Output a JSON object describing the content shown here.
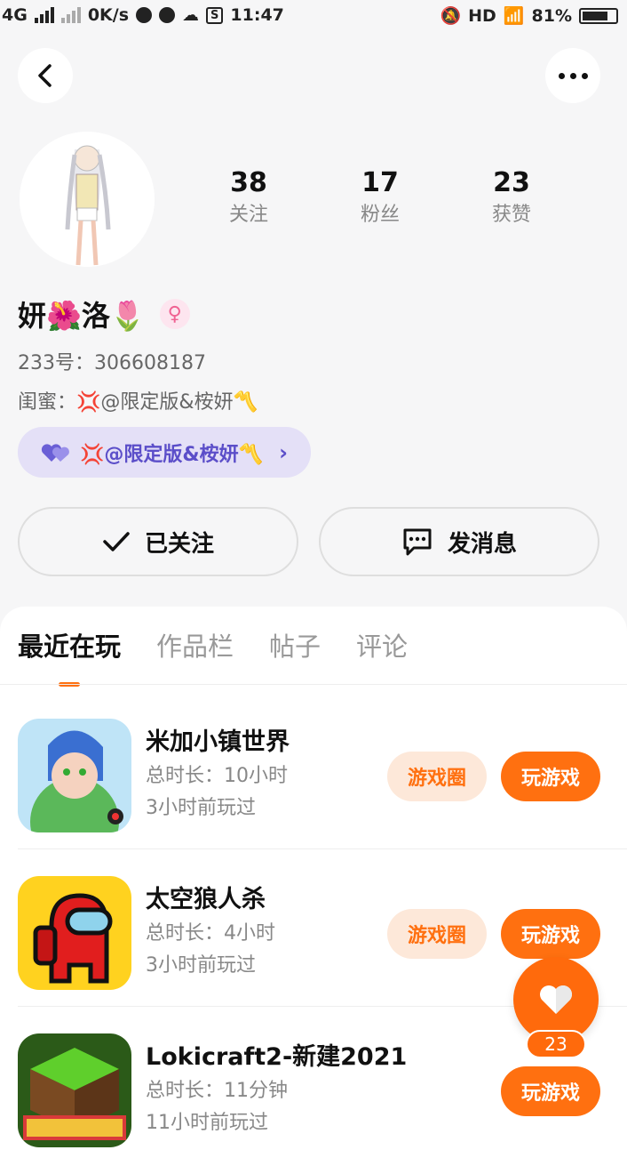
{
  "status_bar": {
    "network": "4G",
    "speed": "0K/s",
    "time": "11:47",
    "hd": "HD",
    "battery": "81%",
    "battery_level": 0.81
  },
  "header": {
    "back_icon": "chevron-left-icon",
    "more_icon": "more-horizontal-icon"
  },
  "profile": {
    "stats": [
      {
        "value": "38",
        "label": "关注"
      },
      {
        "value": "17",
        "label": "粉丝"
      },
      {
        "value": "23",
        "label": "获赞"
      }
    ],
    "name": "妍🌺洛🌷",
    "gender_icon": "♀",
    "uid": "233号：306608187",
    "bff_label": "闺蜜：",
    "bff_name": "💢@限定版&桉妍〽️",
    "bff_pill_text": "💢@限定版&桉妍〽️"
  },
  "actions": {
    "follow_label": "已关注",
    "message_label": "发消息"
  },
  "tabs": [
    "最近在玩",
    "作品栏",
    "帖子",
    "评论"
  ],
  "games": [
    {
      "title": "米加小镇世界",
      "duration": "总时长：10小时",
      "last_played": "3小时前玩过",
      "circle_label": "游戏圈",
      "play_label": "玩游戏"
    },
    {
      "title": "太空狼人杀",
      "duration": "总时长：4小时",
      "last_played": "3小时前玩过",
      "circle_label": "游戏圈",
      "play_label": "玩游戏"
    },
    {
      "title": "Lokicraft2-新建2021",
      "duration": "总时长：11分钟",
      "last_played": "11小时前玩过",
      "play_label": "玩游戏"
    }
  ],
  "like_fab": {
    "count": "23"
  },
  "colors": {
    "accent": "#ff7010",
    "bff_bg": "#e4e0f7",
    "bff_text": "#5b4ec9"
  }
}
